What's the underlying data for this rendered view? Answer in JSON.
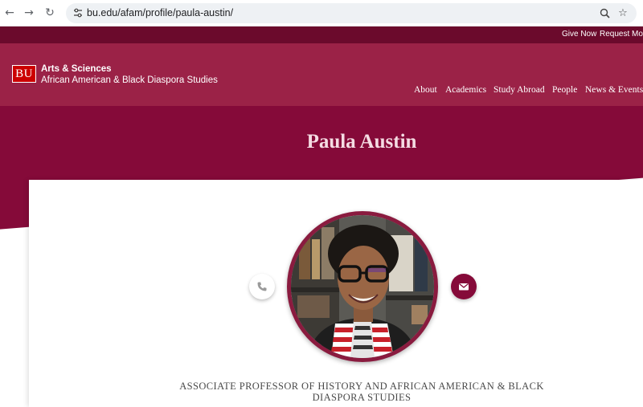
{
  "browser": {
    "url": "bu.edu/afam/profile/paula-austin/"
  },
  "utility": {
    "give_now": "Give Now",
    "request_more": "Request More"
  },
  "header": {
    "logo_text": "BU",
    "college": "Arts & Sciences",
    "department": "African American & Black Diaspora Studies",
    "nav": [
      "About",
      "Academics",
      "Study Abroad",
      "People",
      "News & Events"
    ]
  },
  "profile": {
    "name": "Paula Austin",
    "title_line1": "ASSOCIATE PROFESSOR OF HISTORY AND AFRICAN AMERICAN & BLACK",
    "title_line2": "DIASPORA STUDIES",
    "phone_icon": "phone-icon",
    "email_icon": "envelope-icon"
  },
  "colors": {
    "brand_dark": "#6b0a2c",
    "brand_header": "#9b2247",
    "brand_hero": "#850a39",
    "bu_red": "#cc0000"
  }
}
